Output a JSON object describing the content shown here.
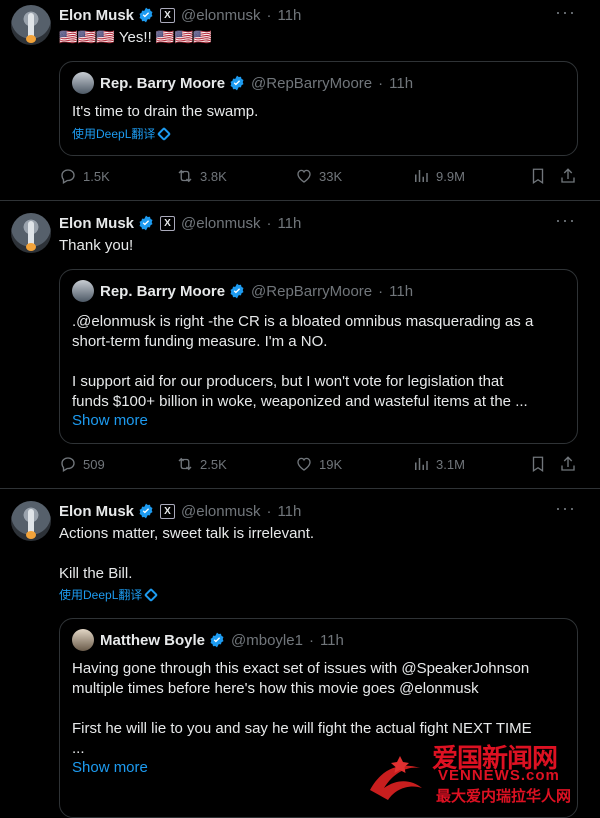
{
  "tweets": [
    {
      "author": {
        "name": "Elon Musk",
        "handle": "@elonmusk",
        "time": "11h"
      },
      "text": "🇺🇸🇺🇸🇺🇸 Yes!! 🇺🇸🇺🇸🇺🇸",
      "translate": "",
      "quote": {
        "author": {
          "name": "Rep. Barry Moore",
          "handle": "@RepBarryMoore",
          "time": "11h"
        },
        "text": "It's time to drain the swamp.",
        "translate": "使用DeepL翻译",
        "show_more": ""
      },
      "stats": {
        "replies": "1.5K",
        "reposts": "3.8K",
        "likes": "33K",
        "views": "9.9M"
      }
    },
    {
      "author": {
        "name": "Elon Musk",
        "handle": "@elonmusk",
        "time": "11h"
      },
      "text": "Thank you!",
      "translate": "",
      "quote": {
        "author": {
          "name": "Rep. Barry Moore",
          "handle": "@RepBarryMoore",
          "time": "11h"
        },
        "text": ".@elonmusk is right -the CR is a bloated omnibus masquerading as a\nshort-term funding measure. I'm a NO.\n\nI support aid for our producers, but I won't vote for legislation that\nfunds $100+ billion in woke, weaponized and wasteful items at the ...",
        "translate": "",
        "show_more": "Show more"
      },
      "stats": {
        "replies": "509",
        "reposts": "2.5K",
        "likes": "19K",
        "views": "3.1M"
      }
    },
    {
      "author": {
        "name": "Elon Musk",
        "handle": "@elonmusk",
        "time": "11h"
      },
      "text": "Actions matter, sweet talk is irrelevant.\n\nKill the Bill.",
      "translate": "使用DeepL翻译",
      "quote": {
        "author": {
          "name": "Matthew Boyle",
          "handle": "@mboyle1",
          "time": "11h"
        },
        "text": "Having gone through this exact set of issues with @SpeakerJohnson\nmultiple times before here's how this movie goes @elonmusk\n\nFirst he will lie to you and say he will fight the actual fight NEXT TIME\n...",
        "translate": "",
        "show_more": "Show more"
      },
      "stats": {}
    }
  ],
  "watermark": {
    "title": "爱国新闻网",
    "url": "VENNEWS.com",
    "subtitle": "最大爱内瑞拉华人网"
  },
  "colors": {
    "background": "#000000",
    "text": "#e7e9ea",
    "muted": "#71767b",
    "link": "#1d9bf0",
    "border": "#2f3336",
    "verified": "#1d9bf0"
  },
  "icons": {
    "reply": "reply-icon",
    "repost": "repost-icon",
    "like": "heart-icon",
    "views": "views-icon",
    "bookmark": "bookmark-icon",
    "share": "share-icon",
    "more": "more-icon"
  }
}
